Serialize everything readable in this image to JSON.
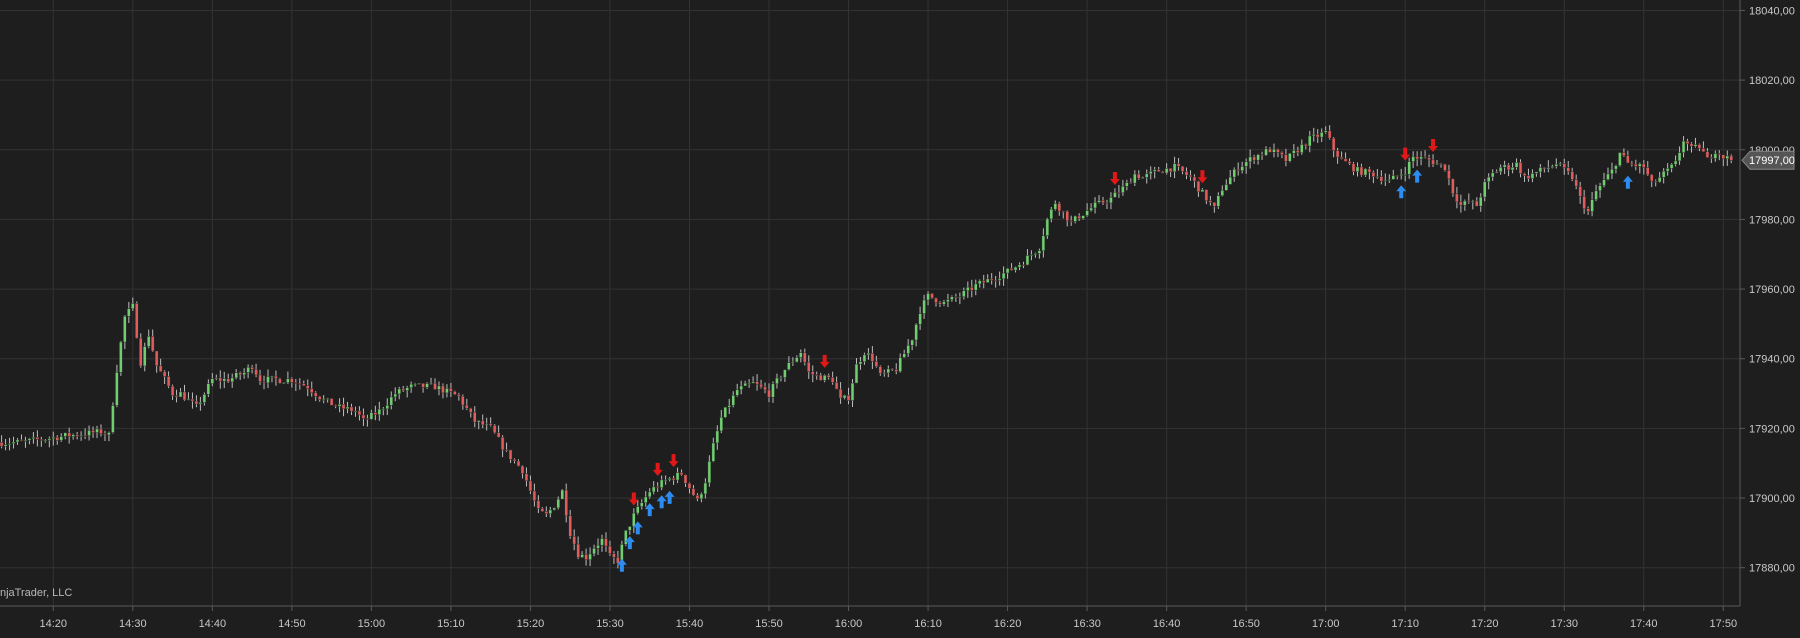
{
  "watermark": "njaTrader, LLC",
  "colors": {
    "background": "#1e1e1e",
    "grid": "#333333",
    "axis": "#5a5a5a",
    "up": "#6fcf6f",
    "down": "#e25c5c",
    "wick": "#bdbdbd",
    "buy_arrow": "#2d8cf0",
    "sell_arrow": "#e01818",
    "text": "#c8c8c8",
    "price_tag_bg": "#555555"
  },
  "chart_data": {
    "type": "candlestick",
    "ylim": [
      17869,
      18043
    ],
    "y_ticks": [
      {
        "value": 17880,
        "label": "17880,00"
      },
      {
        "value": 17900,
        "label": "17900,00"
      },
      {
        "value": 17920,
        "label": "17920,00"
      },
      {
        "value": 17940,
        "label": "17940,00"
      },
      {
        "value": 17960,
        "label": "17960,00"
      },
      {
        "value": 17980,
        "label": "17980,00"
      },
      {
        "value": 18000,
        "label": "18000,00"
      },
      {
        "value": 18020,
        "label": "18020,00"
      },
      {
        "value": 18040,
        "label": "18040,00"
      }
    ],
    "x_range_minutes": [
      853.3,
      1072.1
    ],
    "x_ticks": [
      {
        "minute": 860,
        "label": "14:20"
      },
      {
        "minute": 870,
        "label": "14:30"
      },
      {
        "minute": 880,
        "label": "14:40"
      },
      {
        "minute": 890,
        "label": "14:50"
      },
      {
        "minute": 900,
        "label": "15:00"
      },
      {
        "minute": 910,
        "label": "15:10"
      },
      {
        "minute": 920,
        "label": "15:20"
      },
      {
        "minute": 930,
        "label": "15:30"
      },
      {
        "minute": 940,
        "label": "15:40"
      },
      {
        "minute": 950,
        "label": "15:50"
      },
      {
        "minute": 960,
        "label": "16:00"
      },
      {
        "minute": 970,
        "label": "16:10"
      },
      {
        "minute": 980,
        "label": "16:20"
      },
      {
        "minute": 990,
        "label": "16:30"
      },
      {
        "minute": 1000,
        "label": "16:40"
      },
      {
        "minute": 1010,
        "label": "16:50"
      },
      {
        "minute": 1020,
        "label": "17:00"
      },
      {
        "minute": 1030,
        "label": "17:10"
      },
      {
        "minute": 1040,
        "label": "17:20"
      },
      {
        "minute": 1050,
        "label": "17:30"
      },
      {
        "minute": 1060,
        "label": "17:40"
      },
      {
        "minute": 1070,
        "label": "17:50"
      }
    ],
    "last_price": 17997,
    "last_price_label": "17997,00",
    "waypoints": [
      [
        853.5,
        17916
      ],
      [
        856,
        17916
      ],
      [
        859,
        17917
      ],
      [
        862,
        17918
      ],
      [
        866,
        17919
      ],
      [
        867,
        17918
      ],
      [
        868,
        17937
      ],
      [
        869,
        17952
      ],
      [
        870,
        17955
      ],
      [
        871,
        17939
      ],
      [
        872,
        17947
      ],
      [
        873,
        17938
      ],
      [
        874,
        17934
      ],
      [
        875,
        17930
      ],
      [
        876,
        17930
      ],
      [
        878,
        17926
      ],
      [
        880,
        17934
      ],
      [
        882,
        17934
      ],
      [
        884,
        17936
      ],
      [
        885,
        17938
      ],
      [
        886,
        17934
      ],
      [
        888,
        17934
      ],
      [
        890,
        17934
      ],
      [
        892,
        17932
      ],
      [
        894,
        17928
      ],
      [
        896,
        17926
      ],
      [
        898,
        17925
      ],
      [
        899,
        17922
      ],
      [
        901,
        17925
      ],
      [
        903,
        17930
      ],
      [
        905,
        17932
      ],
      [
        908,
        17932
      ],
      [
        910,
        17930
      ],
      [
        911,
        17929
      ],
      [
        913,
        17922
      ],
      [
        915,
        17920
      ],
      [
        917,
        17913
      ],
      [
        919,
        17908
      ],
      [
        921,
        17896
      ],
      [
        922,
        17895
      ],
      [
        923,
        17898
      ],
      [
        924,
        17902
      ],
      [
        925,
        17890
      ],
      [
        926,
        17884
      ],
      [
        927,
        17883
      ],
      [
        928,
        17886
      ],
      [
        929,
        17888
      ],
      [
        930,
        17883
      ],
      [
        931,
        17882
      ],
      [
        932,
        17890
      ],
      [
        933,
        17895
      ],
      [
        935,
        17902
      ],
      [
        937,
        17905
      ],
      [
        939,
        17907
      ],
      [
        940,
        17903
      ],
      [
        941,
        17899
      ],
      [
        942,
        17905
      ],
      [
        943,
        17915
      ],
      [
        944,
        17923
      ],
      [
        945,
        17927
      ],
      [
        946,
        17931
      ],
      [
        948,
        17933
      ],
      [
        950,
        17930
      ],
      [
        952,
        17937
      ],
      [
        954,
        17942
      ],
      [
        955,
        17936
      ],
      [
        956,
        17935
      ],
      [
        958,
        17934
      ],
      [
        959,
        17928
      ],
      [
        960,
        17929
      ],
      [
        961,
        17938
      ],
      [
        962,
        17942
      ],
      [
        963,
        17940
      ],
      [
        964,
        17935
      ],
      [
        966,
        17937
      ],
      [
        968,
        17946
      ],
      [
        969,
        17954
      ],
      [
        970,
        17958
      ],
      [
        972,
        17956
      ],
      [
        974,
        17958
      ],
      [
        976,
        17961
      ],
      [
        978,
        17963
      ],
      [
        980,
        17965
      ],
      [
        982,
        17968
      ],
      [
        984,
        17972
      ],
      [
        985,
        17980
      ],
      [
        986,
        17985
      ],
      [
        987,
        17982
      ],
      [
        988,
        17979
      ],
      [
        989,
        17981
      ],
      [
        991,
        17984
      ],
      [
        993,
        17986
      ],
      [
        995,
        17990
      ],
      [
        996,
        17993
      ],
      [
        997,
        17992
      ],
      [
        999,
        17994
      ],
      [
        1001,
        17995
      ],
      [
        1003,
        17992
      ],
      [
        1005,
        17986
      ],
      [
        1006,
        17983
      ],
      [
        1007,
        17989
      ],
      [
        1009,
        17995
      ],
      [
        1011,
        17998
      ],
      [
        1013,
        18000
      ],
      [
        1015,
        17997
      ],
      [
        1016,
        17999
      ],
      [
        1018,
        18003
      ],
      [
        1020,
        18005
      ],
      [
        1021,
        18000
      ],
      [
        1022,
        17997
      ],
      [
        1024,
        17994
      ],
      [
        1026,
        17993
      ],
      [
        1028,
        17991
      ],
      [
        1030,
        17994
      ],
      [
        1031,
        17998
      ],
      [
        1033,
        17997
      ],
      [
        1035,
        17995
      ],
      [
        1036,
        17988
      ],
      [
        1037,
        17984
      ],
      [
        1038,
        17985
      ],
      [
        1039,
        17984
      ],
      [
        1040,
        17990
      ],
      [
        1041,
        17993
      ],
      [
        1042,
        17995
      ],
      [
        1043,
        17995
      ],
      [
        1044,
        17996
      ],
      [
        1045,
        17992
      ],
      [
        1047,
        17994
      ],
      [
        1049,
        17996
      ],
      [
        1051,
        17992
      ],
      [
        1052,
        17986
      ],
      [
        1053,
        17982
      ],
      [
        1054,
        17988
      ],
      [
        1056,
        17994
      ],
      [
        1057,
        17999
      ],
      [
        1058,
        17996
      ],
      [
        1060,
        17995
      ],
      [
        1061,
        17990
      ],
      [
        1062,
        17992
      ],
      [
        1063,
        17994
      ],
      [
        1064,
        17996
      ],
      [
        1065,
        18003
      ],
      [
        1066,
        18000
      ],
      [
        1067,
        18001
      ],
      [
        1068,
        17997
      ],
      [
        1069,
        18000
      ],
      [
        1070,
        17998
      ],
      [
        1071.2,
        17997
      ]
    ],
    "buy_signals": [
      931.5,
      932.5,
      933.5,
      935.0,
      936.5,
      937.5,
      1029.5,
      1031.5,
      1058.0
    ],
    "sell_signals": [
      933.0,
      936.0,
      938.0,
      957.0,
      993.5,
      1004.5,
      1030.0,
      1033.5
    ]
  }
}
